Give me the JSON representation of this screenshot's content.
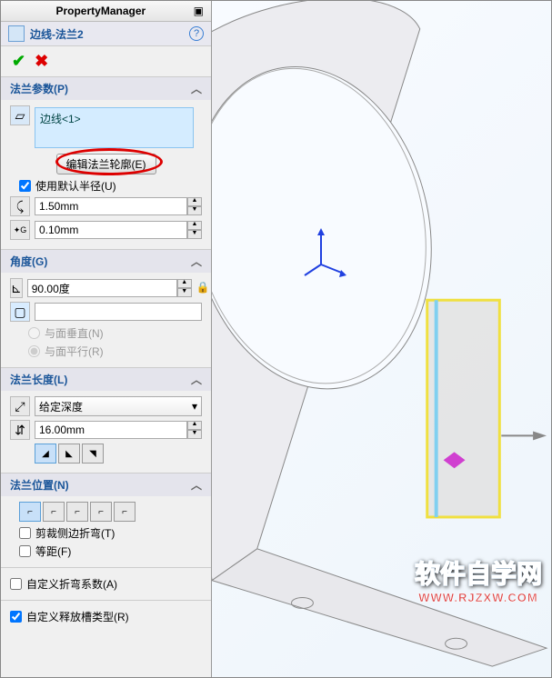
{
  "header": {
    "title": "PropertyManager"
  },
  "feature": {
    "title": "边线-法兰2"
  },
  "flange_params": {
    "header": "法兰参数(P)",
    "edge_item": "边线<1>",
    "edit_profile_btn": "编辑法兰轮廓(E)",
    "use_default_radius": "使用默认半径(U)",
    "use_default_radius_checked": true,
    "bend_radius": "1.50mm",
    "gap": "0.10mm"
  },
  "angle": {
    "header": "角度(G)",
    "value": "90.00度",
    "face_value": "",
    "perpendicular": "与面垂直(N)",
    "parallel": "与面平行(R)",
    "selected": "parallel"
  },
  "flange_length": {
    "header": "法兰长度(L)",
    "type": "给定深度",
    "value": "16.00mm"
  },
  "flange_position": {
    "header": "法兰位置(N)",
    "trim_side_bends": "剪裁侧边折弯(T)",
    "trim_checked": false,
    "offset": "等距(F)",
    "offset_checked": false
  },
  "custom_bend_allowance": {
    "label": "自定义折弯系数(A)",
    "checked": false
  },
  "custom_relief_type": {
    "label": "自定义释放槽类型(R)",
    "checked": true
  },
  "watermark": {
    "main": "软件自学网",
    "sub": "WWW.RJZXW.COM"
  }
}
